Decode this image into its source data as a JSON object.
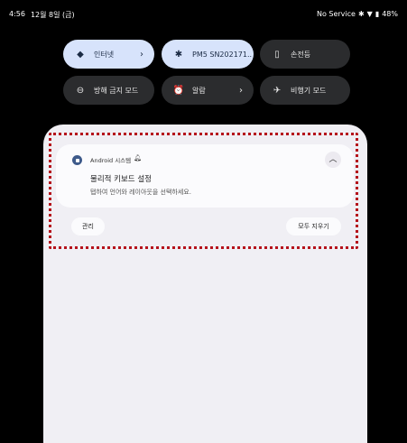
{
  "status": {
    "time": "4:56",
    "date": "12월 8일 (금)",
    "carrier": "No Service",
    "battery": "48%"
  },
  "quick_settings": [
    {
      "label": "인터넷",
      "icon": "wifi-icon",
      "active": true,
      "chevron": true
    },
    {
      "label": "PM5 SN202171..",
      "icon": "bluetooth-icon",
      "active": true,
      "chevron": false
    },
    {
      "label": "손전등",
      "icon": "flashlight-icon",
      "active": false,
      "chevron": false
    },
    {
      "label": "방해 금지 모드",
      "icon": "do-not-disturb-icon",
      "active": false,
      "chevron": false
    },
    {
      "label": "알람",
      "icon": "alarm-icon",
      "active": false,
      "chevron": true
    },
    {
      "label": "비행기 모드",
      "icon": "airplane-icon",
      "active": false,
      "chevron": false
    }
  ],
  "notification": {
    "app_name": "Android 시스템",
    "title": "물리적 키보드 설정",
    "body": "탭하여 언어와 레이아웃을 선택하세요."
  },
  "actions": {
    "manage": "관리",
    "clear_all": "모두 지우기"
  },
  "colors": {
    "active_tile": "#d7e3fb",
    "inactive_tile": "#2b2c2e",
    "panel": "#f0eff4",
    "highlight": "#b5121b"
  }
}
